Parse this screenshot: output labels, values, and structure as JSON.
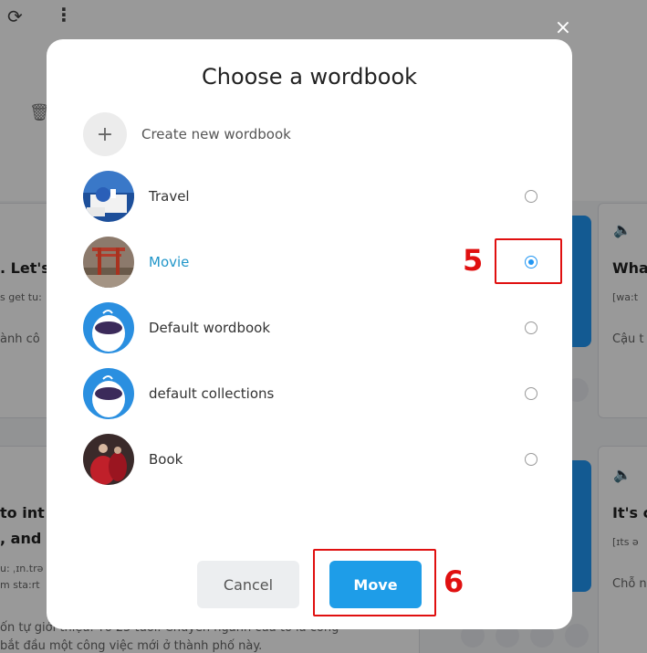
{
  "modal": {
    "title": "Choose a wordbook",
    "create_label": "Create new wordbook",
    "plus_symbol": "+",
    "close_symbol": "×",
    "wordbooks": [
      {
        "label": "Travel",
        "selected": false,
        "icon": "travel-thumbnail"
      },
      {
        "label": "Movie",
        "selected": true,
        "icon": "movie-thumbnail"
      },
      {
        "label": "Default wordbook",
        "selected": false,
        "icon": "mascot-thumbnail"
      },
      {
        "label": "default collections",
        "selected": false,
        "icon": "mascot-thumbnail"
      },
      {
        "label": "Book",
        "selected": false,
        "icon": "book-thumbnail"
      }
    ],
    "cancel_label": "Cancel",
    "move_label": "Move"
  },
  "annotations": {
    "step5": "5",
    "step6": "6"
  },
  "background": {
    "card1_title": ". Let's",
    "card1_phonetic": "s get tu:",
    "card1_translation": "ành cô",
    "card2_title_line1": " to int",
    "card2_title_line2": ", and I",
    "card2_phonetic1": "u: ˌɪn.trə",
    "card2_phonetic2": "m sta:rt",
    "card2_translation1": "ốn tự giới thiệu. Tớ 25 tuổi. Chuyên ngành của tớ là công",
    "card2_translation2": "bắt đầu một công việc mới ở thành phố này.",
    "right1_title": "Wha",
    "right1_phonetic": "[wa:t",
    "right1_translation": "Cậu t",
    "right2_title": "It's c",
    "right2_phonetic": "[ɪts ə",
    "right2_translation": "Chỗ n"
  },
  "colors": {
    "accent": "#1e9de8",
    "annotation": "#e01010",
    "selected_text": "#2196c9"
  }
}
